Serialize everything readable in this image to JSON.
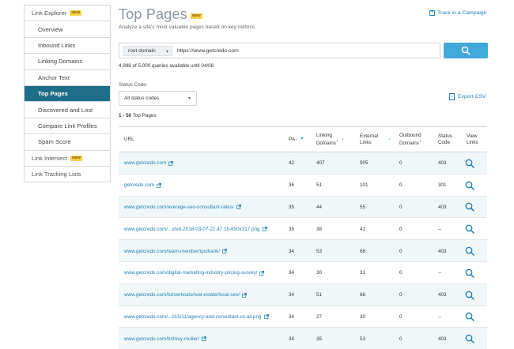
{
  "sidebar": {
    "items": [
      {
        "label": "Link Explorer",
        "level": "top",
        "badge": "NEW",
        "active": false
      },
      {
        "label": "Overview",
        "level": "sub",
        "active": false
      },
      {
        "label": "Inbound Links",
        "level": "sub",
        "active": false
      },
      {
        "label": "Linking Domains",
        "level": "sub",
        "active": false
      },
      {
        "label": "Anchor Text",
        "level": "sub",
        "active": false
      },
      {
        "label": "Top Pages",
        "level": "sub",
        "active": true
      },
      {
        "label": "Discovered and Lost",
        "level": "sub",
        "active": false
      },
      {
        "label": "Compare Link Profiles",
        "level": "sub",
        "active": false
      },
      {
        "label": "Spam Score",
        "level": "sub",
        "active": false
      },
      {
        "label": "Link Intersect",
        "level": "top",
        "badge": "NEW",
        "active": false
      },
      {
        "label": "Link Tracking Lists",
        "level": "top",
        "active": false
      }
    ]
  },
  "header": {
    "title": "Top Pages",
    "badge": "NEW",
    "subtitle": "Analyze a site's most valuable pages based on key metrics.",
    "track_link": "Track in a Campaign"
  },
  "search": {
    "scope": "root domain",
    "value": "https://www.getcredo.com",
    "quota": "4,998 of 5,000 queries available until 04/08"
  },
  "filters": {
    "status_label": "Status Code:",
    "status_value": "All status codes",
    "export_label": "Export CSV"
  },
  "results": {
    "range": "1 - 50",
    "range_label": "Top Pages"
  },
  "table": {
    "headers": {
      "url": "URL",
      "pa": "PA",
      "linking_domains_1": "Linking",
      "linking_domains_2": "Domains",
      "external_links_1": "External",
      "external_links_2": "Links",
      "outbound_domains_1": "Outbound",
      "outbound_domains_2": "Domains",
      "status_code_1": "Status",
      "status_code_2": "Code",
      "view_links_1": "View",
      "view_links_2": "Links"
    },
    "rows": [
      {
        "url": "www.getcredo.com",
        "pa": "42",
        "linking_domains": "407",
        "external_links": "905",
        "outbound_domains": "0",
        "status_code": "403"
      },
      {
        "url": "getcredo.com",
        "pa": "36",
        "linking_domains": "51",
        "external_links": "101",
        "outbound_domains": "0",
        "status_code": "301"
      },
      {
        "url": "www.getcredo.com/average-seo-consultant-rates/",
        "pa": "35",
        "linking_domains": "44",
        "external_links": "55",
        "outbound_domains": "0",
        "status_code": "403"
      },
      {
        "url": "www.getcredo.com/...shot-2018-03-07-21.47.15-650x317.png",
        "pa": "35",
        "linking_domains": "38",
        "external_links": "41",
        "outbound_domains": "0",
        "status_code": "--"
      },
      {
        "url": "www.getcredo.com/team-member/ipullrank/",
        "pa": "34",
        "linking_domains": "53",
        "external_links": "68",
        "outbound_domains": "0",
        "status_code": "403"
      },
      {
        "url": "www.getcredo.com/digital-marketing-industry-pricing-survey/",
        "pa": "34",
        "linking_domains": "30",
        "external_links": "31",
        "outbound_domains": "0",
        "status_code": "--"
      },
      {
        "url": "www.getcredo.com/bizverticals/real-estate/local-seo/",
        "pa": "34",
        "linking_domains": "51",
        "external_links": "66",
        "outbound_domains": "0",
        "status_code": "403"
      },
      {
        "url": "www.getcredo.com/...015/11/agency-and-consultant-vs-all.png",
        "pa": "34",
        "linking_domains": "27",
        "external_links": "30",
        "outbound_domains": "0",
        "status_code": "--"
      },
      {
        "url": "www.getcredo.com/britney-muller/",
        "pa": "34",
        "linking_domains": "35",
        "external_links": "53",
        "outbound_domains": "0",
        "status_code": "403"
      }
    ]
  }
}
